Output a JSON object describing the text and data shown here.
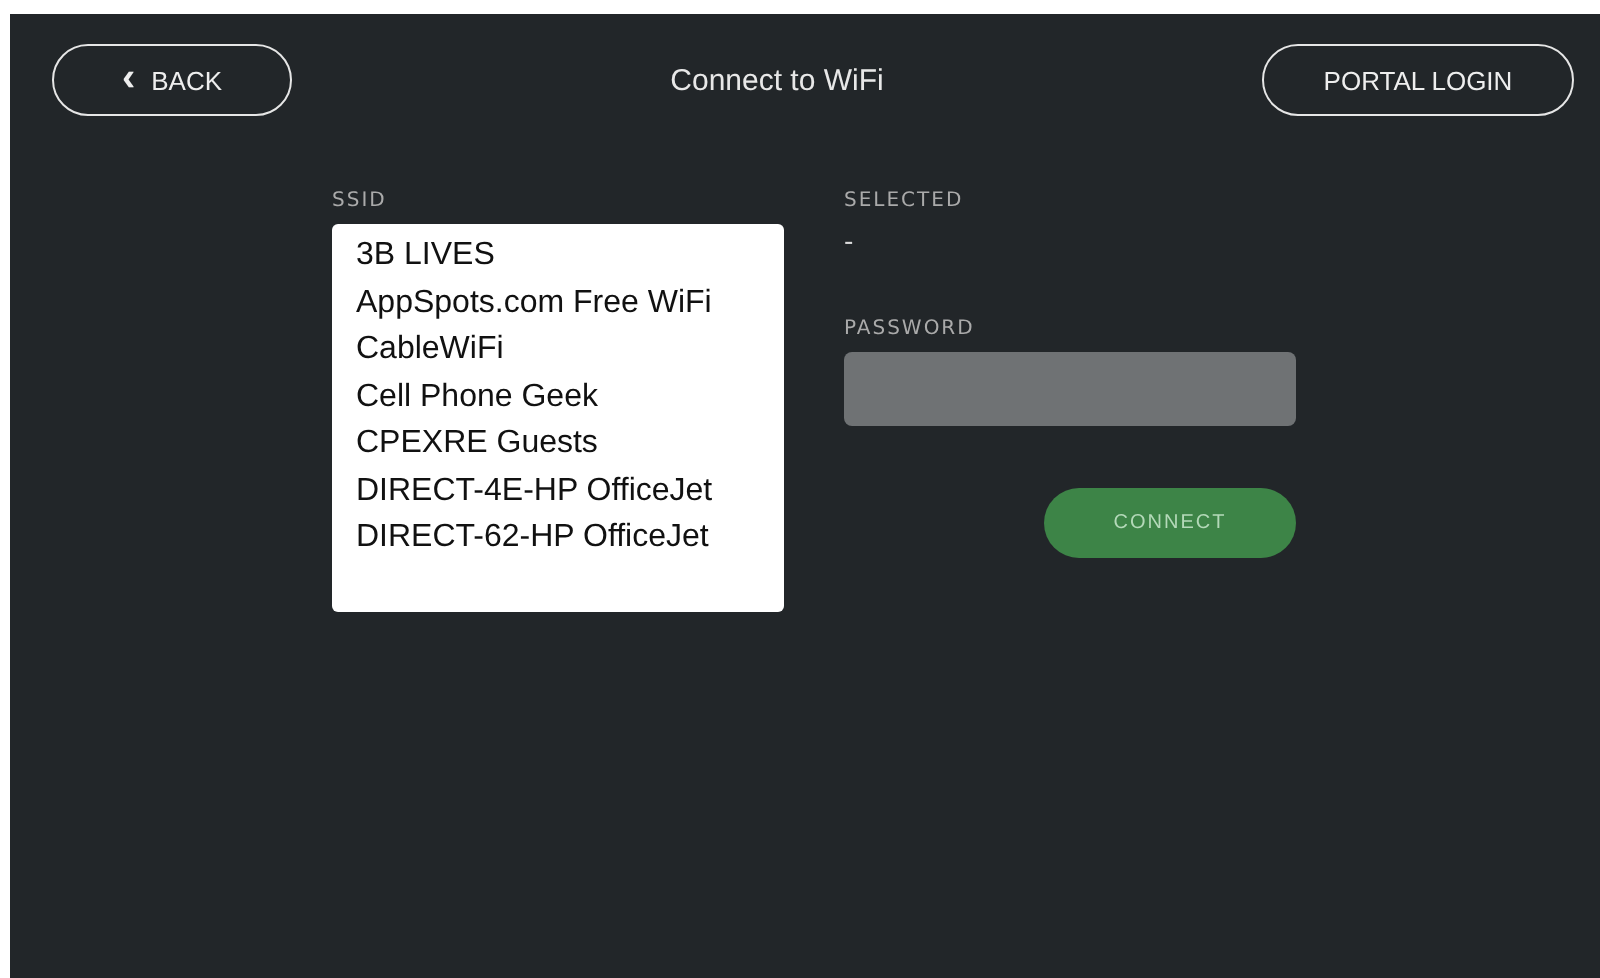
{
  "header": {
    "back_button": {
      "icon": "‹",
      "label": "BACK"
    },
    "title": "Connect to WiFi",
    "portal_button": {
      "label": "PORTAL LOGIN"
    }
  },
  "ssid": {
    "label": "SSID",
    "networks": [
      {
        "name": "3B LIVES",
        "selected": false
      },
      {
        "name": "AppSpots.com Free WiFi",
        "selected": false
      },
      {
        "name": "CableWiFi",
        "selected": false
      },
      {
        "name": "Cell Phone Geek",
        "selected": false
      },
      {
        "name": "CPEXRE Guests",
        "selected": false
      },
      {
        "name": "DIRECT-4E-HP OfficeJet",
        "selected": false
      },
      {
        "name": "DIRECT-62-HP OfficeJet",
        "selected": false
      }
    ]
  },
  "selected": {
    "label": "SELECTED",
    "value": "-"
  },
  "password": {
    "label": "PASSWORD"
  },
  "connect_button": {
    "label": "CONNECT",
    "disabled": true
  }
}
